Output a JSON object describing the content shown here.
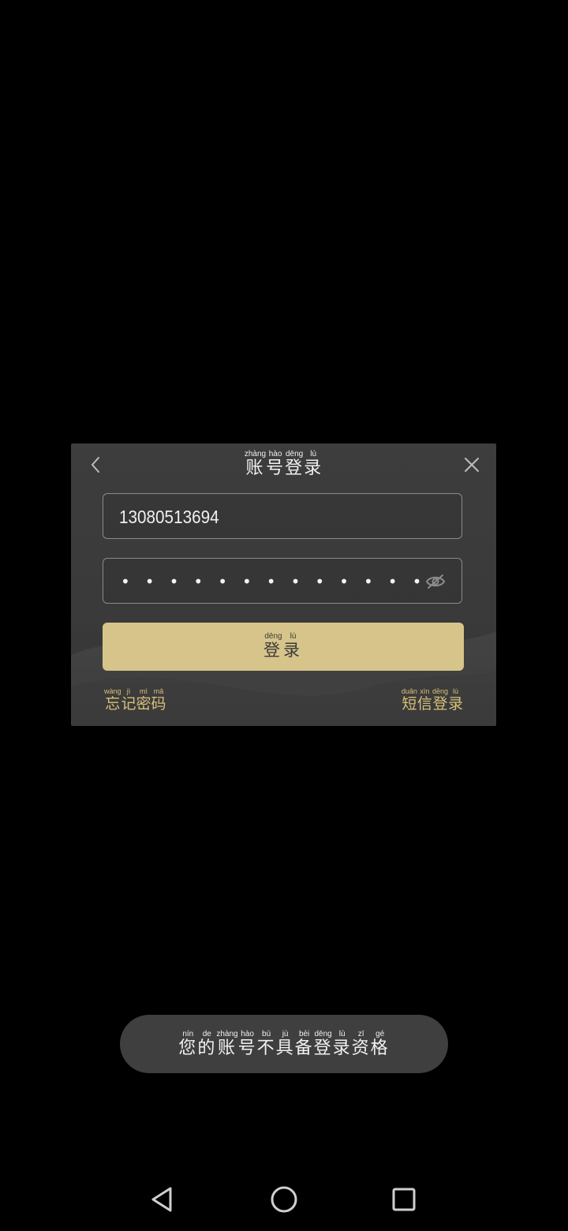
{
  "dialog": {
    "title": [
      {
        "char": "账",
        "pinyin": "zhàng"
      },
      {
        "char": "号",
        "pinyin": "hào"
      },
      {
        "char": "登",
        "pinyin": "dēng"
      },
      {
        "char": "录",
        "pinyin": "lù"
      }
    ],
    "phone_value": "13080513694",
    "password_mask": "•••••••••••••",
    "login_button": [
      {
        "char": "登",
        "pinyin": "dēng"
      },
      {
        "char": "录",
        "pinyin": "lù"
      }
    ],
    "forgot_password": [
      {
        "char": "忘",
        "pinyin": "wàng"
      },
      {
        "char": "记",
        "pinyin": "jì"
      },
      {
        "char": "密",
        "pinyin": "mì"
      },
      {
        "char": "码",
        "pinyin": "mǎ"
      }
    ],
    "sms_login": [
      {
        "char": "短",
        "pinyin": "duǎn"
      },
      {
        "char": "信",
        "pinyin": "xìn"
      },
      {
        "char": "登",
        "pinyin": "dēng"
      },
      {
        "char": "录",
        "pinyin": "lù"
      }
    ]
  },
  "toast": [
    {
      "char": "您",
      "pinyin": "nín"
    },
    {
      "char": "的",
      "pinyin": "de"
    },
    {
      "char": "账",
      "pinyin": "zhàng"
    },
    {
      "char": "号",
      "pinyin": "hào"
    },
    {
      "char": "不",
      "pinyin": "bù"
    },
    {
      "char": "具",
      "pinyin": "jù"
    },
    {
      "char": "备",
      "pinyin": "bèi"
    },
    {
      "char": "登",
      "pinyin": "dēng"
    },
    {
      "char": "录",
      "pinyin": "lù"
    },
    {
      "char": "资",
      "pinyin": "zī"
    },
    {
      "char": "格",
      "pinyin": "gé"
    }
  ],
  "icons": {
    "back": "chevron-left-icon",
    "close": "close-icon",
    "eye": "eye-off-icon",
    "nav_back": "triangle-back-icon",
    "nav_home": "circle-home-icon",
    "nav_recent": "square-recent-icon"
  },
  "colors": {
    "accent": "#d6c48a",
    "link": "#d8c07a",
    "dialog_bg": "#3b3b3b",
    "toast_bg": "#3f3f3f"
  }
}
